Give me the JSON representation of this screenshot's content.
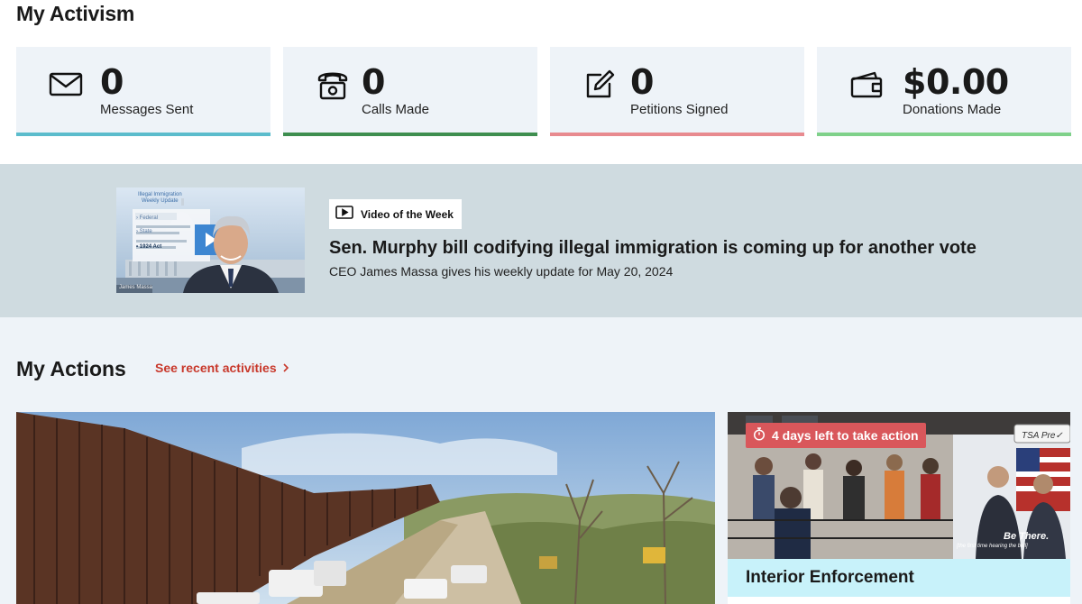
{
  "activism": {
    "title": "My Activism",
    "stats": [
      {
        "value": "0",
        "label": "Messages Sent",
        "icon": "envelope-icon",
        "accent": "#5bbccc"
      },
      {
        "value": "0",
        "label": "Calls Made",
        "icon": "phone-icon",
        "accent": "#3e8e4f"
      },
      {
        "value": "0",
        "label": "Petitions Signed",
        "icon": "edit-icon",
        "accent": "#e88a8f"
      },
      {
        "value": "$0.00",
        "label": "Donations Made",
        "icon": "wallet-icon",
        "accent": "#7fd18a"
      }
    ]
  },
  "video": {
    "badge": "Video of the Week",
    "badge_icon": "play-icon",
    "headline": "Sen. Murphy bill codifying illegal immigration is coming up for another vote",
    "subtitle": "CEO James Massa gives his weekly update for May 20, 2024",
    "thumb": {
      "title_line1": "Illegal Immigration",
      "title_line2": "Weekly Update",
      "item1": "› Federal",
      "item2": "› State",
      "item3": "• 1924 Act",
      "caption": "James Massa"
    }
  },
  "actions": {
    "title": "My Actions",
    "recent_link": "See recent activities",
    "cards": [
      {
        "image": "border-wall-photo"
      },
      {
        "image": "airport-security-photo",
        "timer": "4 days left to take action",
        "timer_icon": "stopwatch-icon",
        "sign_label": "TSA Pre✓",
        "banner_text1": "Be There.",
        "banner_text2": "[the first time hearing the bell]",
        "caption": "Interior Enforcement"
      }
    ]
  },
  "colors": {
    "link_red": "#c8382b",
    "timer_red": "#d9575b",
    "video_band": "#cfdbe0",
    "card_bg": "#eef3f8",
    "caption_bg": "#c8f2fa"
  }
}
